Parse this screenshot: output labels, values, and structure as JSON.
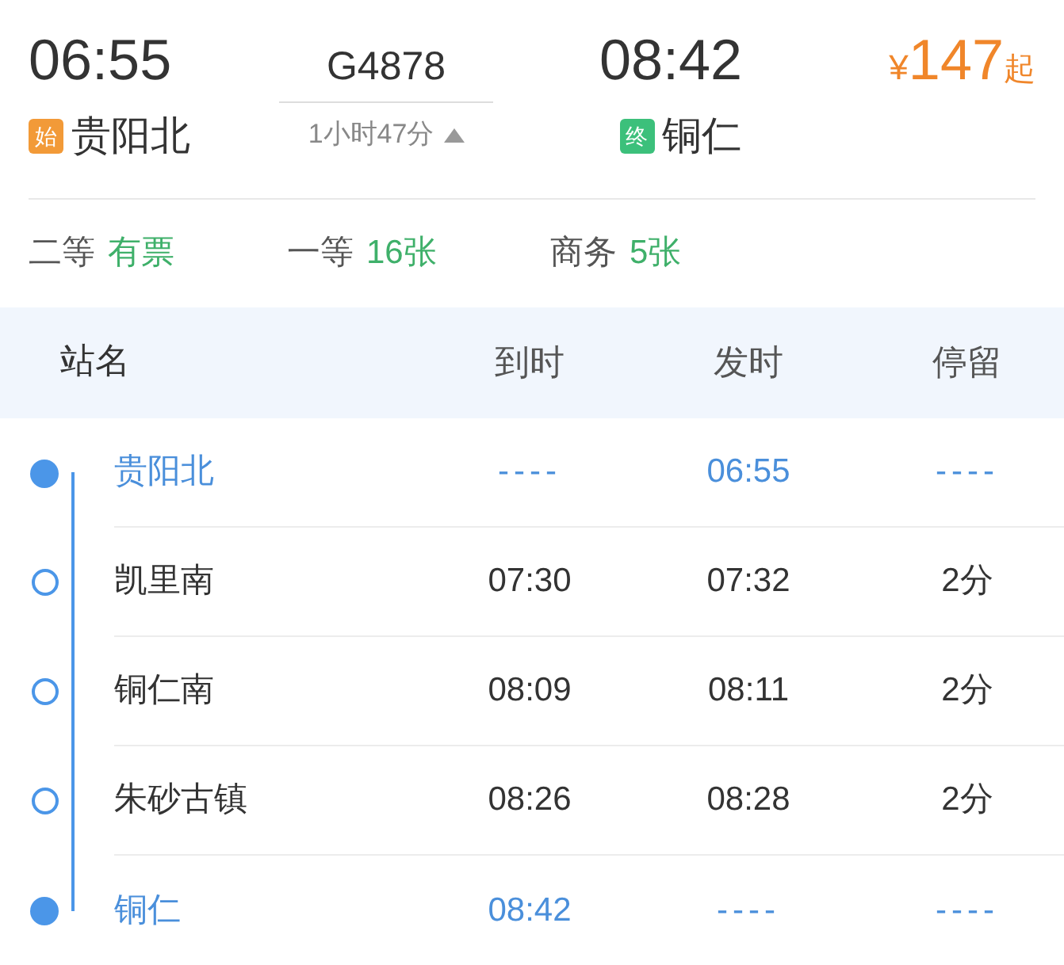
{
  "train": {
    "departure_time": "06:55",
    "departure_badge": "始",
    "departure_station": "贵阳北",
    "number": "G4878",
    "duration": "1小时47分",
    "stops_expanded": true,
    "arrival_time": "08:42",
    "arrival_badge": "终",
    "arrival_station": "铜仁",
    "price_currency": "¥",
    "price": "147",
    "price_suffix": "起"
  },
  "seats": [
    {
      "class": "二等",
      "availability": "有票"
    },
    {
      "class": "一等",
      "availability": "16张"
    },
    {
      "class": "商务",
      "availability": "5张"
    }
  ],
  "table": {
    "columns": [
      "站名",
      "到时",
      "发时",
      "停留"
    ],
    "rows": [
      {
        "kind": "endpoint",
        "station": "贵阳北",
        "arrive": "----",
        "depart": "06:55",
        "stop": "----"
      },
      {
        "kind": "stop",
        "station": "凯里南",
        "arrive": "07:30",
        "depart": "07:32",
        "stop": "2分"
      },
      {
        "kind": "stop",
        "station": "铜仁南",
        "arrive": "08:09",
        "depart": "08:11",
        "stop": "2分"
      },
      {
        "kind": "stop",
        "station": "朱砂古镇",
        "arrive": "08:26",
        "depart": "08:28",
        "stop": "2分"
      },
      {
        "kind": "endpoint",
        "station": "铜仁",
        "arrive": "08:42",
        "depart": "----",
        "stop": "----"
      }
    ]
  }
}
